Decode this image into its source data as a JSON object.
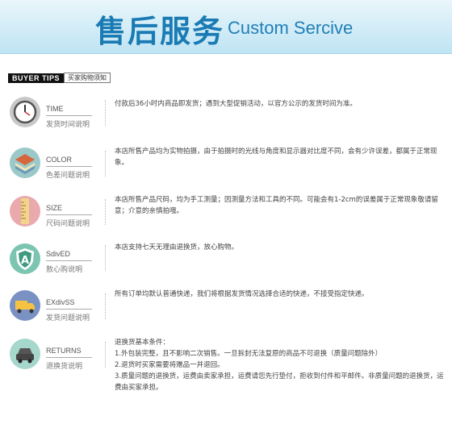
{
  "header": {
    "title_cn": "售后服务",
    "title_en": "Custom Sercive"
  },
  "tips": {
    "badge": "BUYER TIPS",
    "title": "买家购物须知"
  },
  "items": [
    {
      "en": "TIME",
      "cn": "发货时间说明",
      "icon": "clock-icon",
      "lines": [
        "付款后36小时内商品即发货；遇到大型促销活动，以官方公示的发货时间为准。"
      ]
    },
    {
      "en": "COLOR",
      "cn": "色差问题说明",
      "icon": "color-layers-icon",
      "lines": [
        "本店所售产品均为实物拍摄，由于拍摄时的光线与角度和显示器对比度不同，会有少许误差，都属于正常现象。"
      ]
    },
    {
      "en": "SIZE",
      "cn": "尺码问题说明",
      "icon": "ruler-icon",
      "lines": [
        "本店所售产品尺码，均为手工测量；因测量方法和工具的不同。可能会有1-2cm的误差属于正常现象敬请留意；介意的亲慎拍哦。"
      ]
    },
    {
      "en": "SdivED",
      "cn": "敖心购说明",
      "icon": "shield-icon",
      "lines": [
        "本店支持七天无理由退换货，放心购物。"
      ]
    },
    {
      "en": "EXdivSS",
      "cn": "发货问题说明",
      "icon": "truck-icon",
      "lines": [
        "所有订单均默认普通快递，我们将根据发货情况选择合适的快递，不接受指定快递。"
      ]
    },
    {
      "en": "RETURNS",
      "cn": "退换货说明",
      "icon": "car-icon",
      "lines": [
        "退换货基本条件：",
        "1.外包装完整，且不影响二次销售。一旦拆封无法复原的商品不可退换（质量问题除外）",
        "2.退货时买家需要将赠品一并退回。",
        "3.质量问题的退换货，运费由卖家承担，运费请您先行垫付，拒收到付件和平邮件。非质量问题的退换货，运费由买家承担。"
      ]
    }
  ],
  "colors": {
    "banner_text": "#1a7bb4",
    "clock": "#c8c8c8",
    "color_icon": "#9bc8c8",
    "size_icon": "#e9a9ad",
    "shield_icon": "#7cc5b0",
    "truck_icon": "#7a92c3",
    "car_icon": "#a6d7cc"
  }
}
